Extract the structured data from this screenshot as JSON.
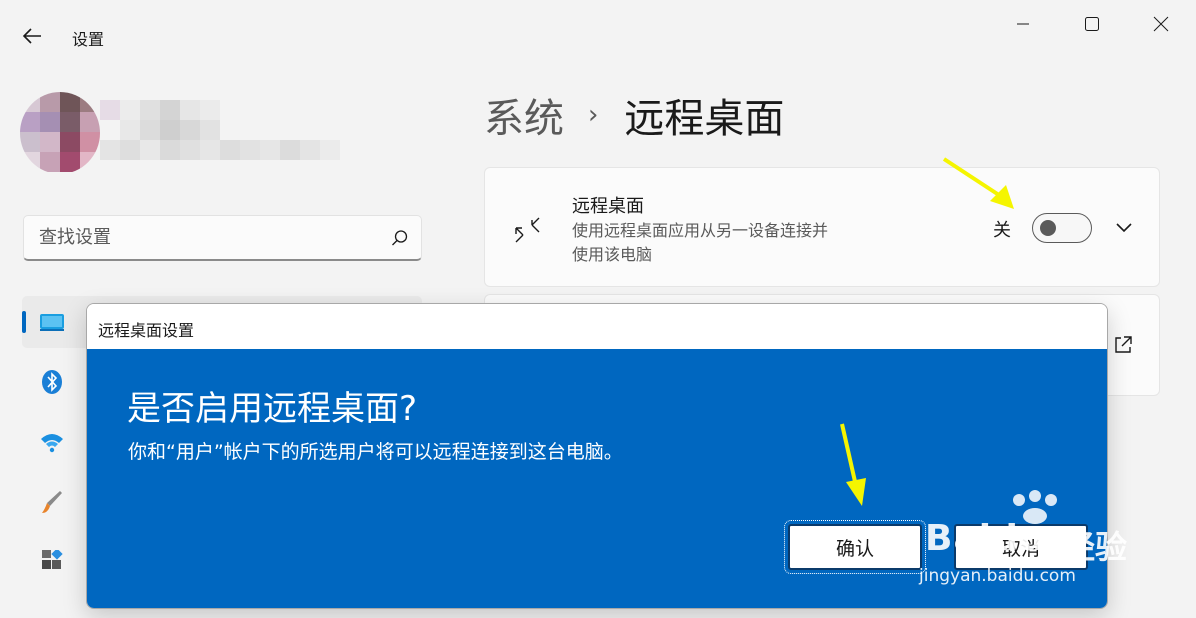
{
  "window": {
    "app_title": "设置",
    "controls": [
      "minimize-icon",
      "maximize-icon",
      "close-icon"
    ]
  },
  "search": {
    "placeholder": "查找设置"
  },
  "sidebar": {
    "items": [
      {
        "icon": "system-icon",
        "selected": true
      },
      {
        "icon": "bluetooth-icon"
      },
      {
        "icon": "network-wifi-icon"
      },
      {
        "icon": "personalization-brush-icon"
      },
      {
        "icon": "apps-icon"
      }
    ]
  },
  "breadcrumb": {
    "parent": "系统",
    "separator": "›",
    "current": "远程桌面"
  },
  "remote_desktop_card": {
    "title": "远程桌面",
    "description": "使用远程桌面应用从另一设备连接并使用该电脑",
    "toggle_state_label": "关",
    "toggle_on": false
  },
  "dialog": {
    "title": "远程桌面设置",
    "heading": "是否启用远程桌面?",
    "message": "你和“用户”帐户下的所选用户将可以远程连接到这台电脑。",
    "confirm_label": "确认",
    "cancel_label": "取消",
    "accent_color": "#0067c0"
  },
  "watermark": {
    "brand": "Baidu",
    "cn": "经验",
    "url": "jingyan.baidu.com"
  },
  "colors": {
    "accent": "#0067c0",
    "annotation_arrow": "#f5f500"
  }
}
